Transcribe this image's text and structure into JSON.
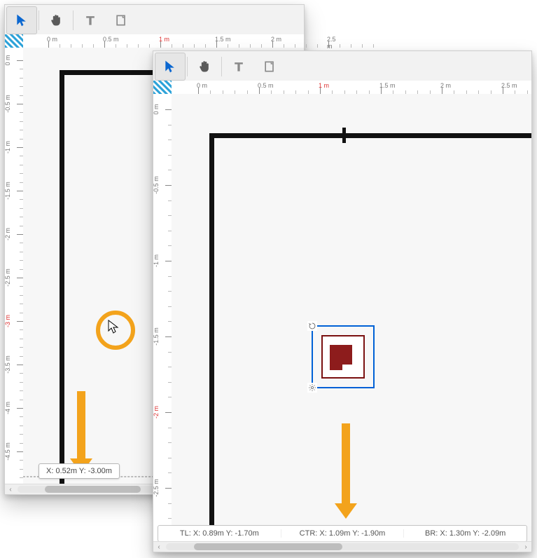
{
  "tools": {
    "select": "select-tool",
    "pan": "pan-tool",
    "text": "text-tool",
    "rect": "rectangle-tool"
  },
  "left_window": {
    "ruler_h": [
      "0 m",
      "0.5 m",
      "1 m",
      "1.5 m",
      "2 m",
      "2.5 m"
    ],
    "ruler_v": [
      "0 m",
      "-0.5 m",
      "-1 m",
      "-1.5 m",
      "-2 m",
      "-2.5 m",
      "-3 m",
      "-3.5 m",
      "-4 m",
      "-4.5 m"
    ],
    "tooltip": "X: 0.52m Y: -3.00m"
  },
  "right_window": {
    "ruler_h": [
      "0 m",
      "0.5 m",
      "1 m",
      "1.5 m",
      "2 m",
      "2.5 m"
    ],
    "ruler_v": [
      "0 m",
      "-0.5 m",
      "-1 m",
      "-1.5 m",
      "-2 m",
      "-2.5 m"
    ],
    "status": {
      "tl": "TL: X: 0.89m Y: -1.70m",
      "ctr": "CTR: X: 1.09m Y: -1.90m",
      "br": "BR: X: 1.30m Y: -2.09m"
    }
  }
}
